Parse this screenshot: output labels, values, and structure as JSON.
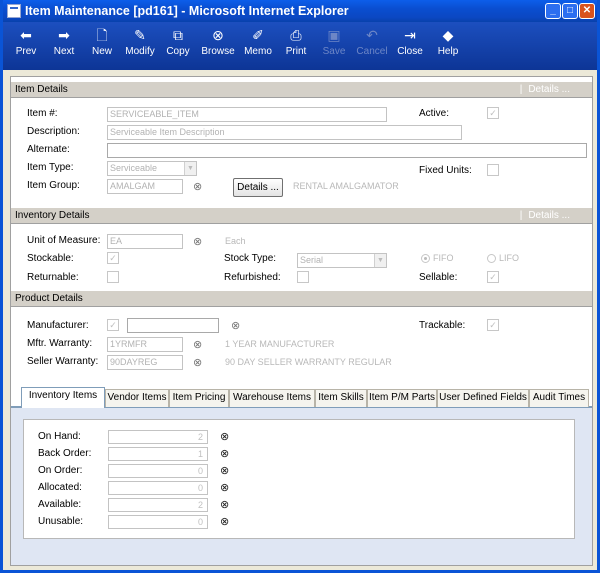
{
  "window": {
    "title": "Item Maintenance [pd161] - Microsoft Internet Explorer"
  },
  "toolbar": {
    "buttons": [
      {
        "label": "Prev",
        "icon": "arrow-left-icon",
        "enabled": true
      },
      {
        "label": "Next",
        "icon": "arrow-right-icon",
        "enabled": true
      },
      {
        "label": "New",
        "icon": "new-doc-icon",
        "enabled": true
      },
      {
        "label": "Modify",
        "icon": "modify-icon",
        "enabled": true
      },
      {
        "label": "Copy",
        "icon": "copy-icon",
        "enabled": true
      },
      {
        "label": "Browse",
        "icon": "binoculars-icon",
        "enabled": true
      },
      {
        "label": "Memo",
        "icon": "memo-icon",
        "enabled": true
      },
      {
        "label": "Print",
        "icon": "printer-icon",
        "enabled": true
      },
      {
        "label": "Save",
        "icon": "save-icon",
        "enabled": false
      },
      {
        "label": "Cancel",
        "icon": "undo-icon",
        "enabled": false
      },
      {
        "label": "Close",
        "icon": "close-door-icon",
        "enabled": true
      },
      {
        "label": "Help",
        "icon": "help-icon",
        "enabled": true
      }
    ]
  },
  "item_details": {
    "header": "Item Details",
    "header_link": "Details ...",
    "item_no_label": "Item #:",
    "item_no": "SERVICEABLE_ITEM",
    "active_label": "Active:",
    "description_label": "Description:",
    "description": "Serviceable Item Description",
    "alternate_label": "Alternate:",
    "alternate": "",
    "item_type_label": "Item Type:",
    "item_type": "Serviceable",
    "fixed_units_label": "Fixed Units:",
    "item_group_label": "Item Group:",
    "item_group": "AMALGAM",
    "details_button": "Details ...",
    "item_group_desc": "RENTAL AMALGAMATOR"
  },
  "inventory_details": {
    "header": "Inventory Details",
    "header_link": "Details ...",
    "uom_label": "Unit of Measure:",
    "uom": "EA",
    "uom_desc": "Each",
    "stockable_label": "Stockable:",
    "stock_type_label": "Stock Type:",
    "stock_type": "Serial",
    "fifo_label": "FIFO",
    "lifo_label": "LIFO",
    "returnable_label": "Returnable:",
    "refurbished_label": "Refurbished:",
    "sellable_label": "Sellable:"
  },
  "product_details": {
    "header": "Product Details",
    "manufacturer_label": "Manufacturer:",
    "trackable_label": "Trackable:",
    "mftr_warranty_label": "Mftr. Warranty:",
    "mftr_warranty": "1YRMFR",
    "mftr_warranty_desc": "1 YEAR MANUFACTURER",
    "seller_warranty_label": "Seller Warranty:",
    "seller_warranty": "90DAYREG",
    "seller_warranty_desc": "90 DAY SELLER WARRANTY REGULAR"
  },
  "tabs": [
    {
      "label": "Inventory Items",
      "active": true
    },
    {
      "label": "Vendor Items"
    },
    {
      "label": "Item Pricing"
    },
    {
      "label": "Warehouse Items"
    },
    {
      "label": "Item Skills"
    },
    {
      "label": "Item P/M Parts"
    },
    {
      "label": "User Defined Fields"
    },
    {
      "label": "Audit Times"
    }
  ],
  "inventory_items": {
    "rows": [
      {
        "label": "On Hand:",
        "value": "2"
      },
      {
        "label": "Back Order:",
        "value": "1"
      },
      {
        "label": "On Order:",
        "value": "0"
      },
      {
        "label": "Allocated:",
        "value": "0"
      },
      {
        "label": "Available:",
        "value": "2"
      },
      {
        "label": "Unusable:",
        "value": "0"
      }
    ]
  }
}
